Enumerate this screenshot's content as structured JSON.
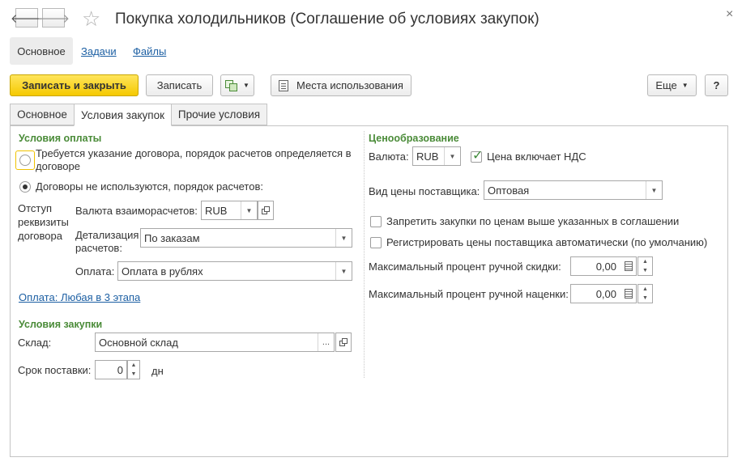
{
  "window": {
    "title": "Покупка холодильников (Соглашение об условиях закупок)",
    "close_glyph": "×",
    "back_glyph": "🡐",
    "forward_glyph": "🡒",
    "star_glyph": "☆"
  },
  "nav": {
    "main": "Основное",
    "tasks": "Задачи",
    "files": "Файлы"
  },
  "toolbar": {
    "save_close": "Записать и закрыть",
    "save": "Записать",
    "usage": "Места использования",
    "more": "Еще",
    "help": "?"
  },
  "tabs": [
    "Основное",
    "Условия закупок",
    "Прочие условия"
  ],
  "payment": {
    "title": "Условия оплаты",
    "option1": "Требуется указание договора, порядок расчетов определяется в договоре",
    "option2": "Договоры не используются, порядок расчетов:",
    "indent_label": "Отступ реквизиты договора",
    "currency_label": "Валюта взаиморасчетов:",
    "currency_value": "RUB",
    "detail_label": "Детализация расчетов:",
    "detail_value": "По заказам",
    "pay_label": "Оплата:",
    "pay_value": "Оплата в рублях",
    "schedule_link": "Оплата: Любая в 3 этапа"
  },
  "purchase": {
    "title": "Условия закупки",
    "warehouse_label": "Склад:",
    "warehouse_value": "Основной склад",
    "lead_label": "Срок поставки:",
    "lead_value": "0",
    "lead_unit": "дн"
  },
  "pricing": {
    "title": "Ценообразование",
    "currency_label": "Валюта:",
    "currency_value": "RUB",
    "vat_label": "Цена включает НДС",
    "vat_checked": true,
    "price_type_label": "Вид цены поставщика:",
    "price_type_value": "Оптовая",
    "forbid_label": "Запретить закупки по ценам выше указанных в соглашении",
    "register_label": "Регистрировать цены поставщика автоматически (по умолчанию)",
    "discount_label": "Максимальный процент ручной скидки:",
    "discount_value": "0,00",
    "markup_label": "Максимальный процент ручной наценки:",
    "markup_value": "0,00"
  },
  "colors": {
    "accent_yellow": "#f5c900",
    "section_green": "#4a8b38",
    "link_blue": "#1c5fa3"
  }
}
